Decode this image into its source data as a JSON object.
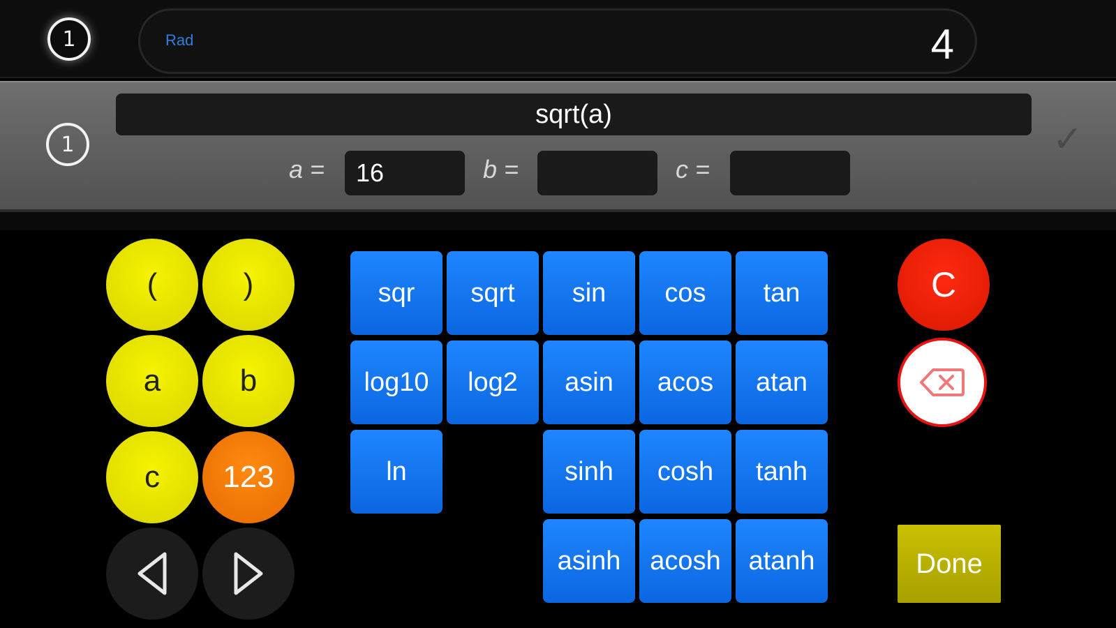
{
  "result_bar": {
    "history_icon": "1",
    "mode": "Rad",
    "value": "4"
  },
  "expression": {
    "history_icon": "1",
    "text": "sqrt(a)",
    "vars": [
      {
        "label": "a =",
        "value": "16"
      },
      {
        "label": "b =",
        "value": ""
      },
      {
        "label": "c =",
        "value": ""
      }
    ],
    "confirm_icon": "check-icon"
  },
  "keys": {
    "open_paren": "(",
    "close_paren": ")",
    "var_a": "a",
    "var_b": "b",
    "var_c": "c",
    "numpad": "123",
    "left_icon": "left-triangle-icon",
    "right_icon": "right-triangle-icon",
    "functions": {
      "sqr": "sqr",
      "sqrt": "sqrt",
      "sin": "sin",
      "cos": "cos",
      "tan": "tan",
      "log10": "log10",
      "log2": "log2",
      "asin": "asin",
      "acos": "acos",
      "atan": "atan",
      "ln": "ln",
      "sinh": "sinh",
      "cosh": "cosh",
      "tanh": "tanh",
      "asinh": "asinh",
      "acosh": "acosh",
      "atanh": "atanh"
    },
    "clear": "C",
    "backspace_icon": "backspace-icon",
    "done": "Done"
  },
  "colors": {
    "function_key": "#1479f5",
    "yellow_key": "#f0ed00",
    "orange_key": "#f47a00",
    "clear_key": "#e81e00",
    "done_key": "#b8b000",
    "mode_label": "#2f7fdf"
  }
}
